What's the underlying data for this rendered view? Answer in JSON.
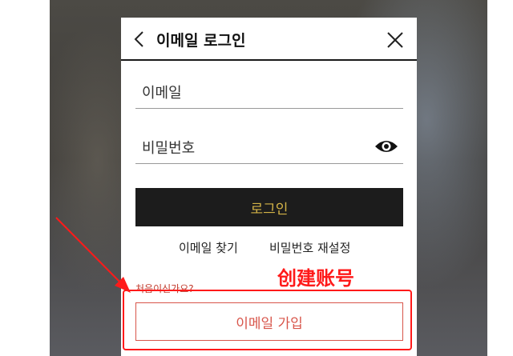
{
  "dialog": {
    "title": "이메일 로그인",
    "email_placeholder": "이메일",
    "password_placeholder": "비밀번호",
    "login_label": "로그인",
    "find_email_label": "이메일 찾기",
    "reset_password_label": "비밀번호 재설정",
    "first_time_label": "처음이신가요?",
    "signup_label": "이메일 가입"
  },
  "icons": {
    "back": "chevron-left-icon",
    "close": "close-icon",
    "password_visibility": "eye-icon"
  },
  "annotation": {
    "label": "创建账号",
    "color": "#ff1a1a"
  },
  "colors": {
    "login_button_bg": "#1c1c1c",
    "login_button_text": "#d3b347",
    "signup_accent": "#d8554a"
  }
}
